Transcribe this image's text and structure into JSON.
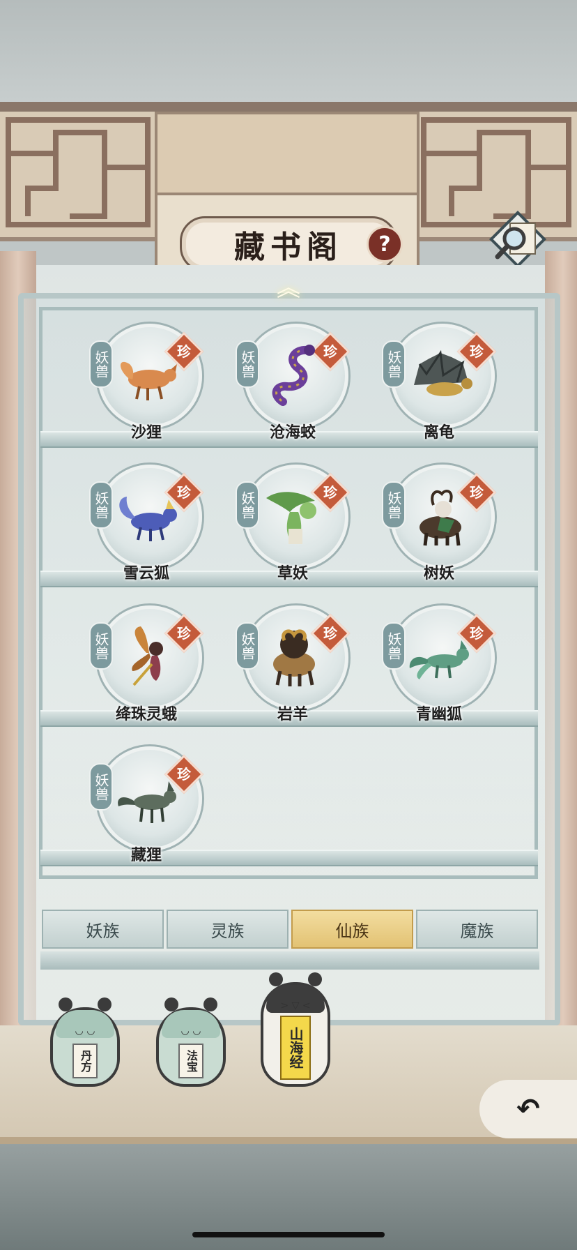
{
  "title": "藏书阁",
  "help_icon": "question-mark-icon",
  "search_icon": "magnifier-scroll-icon",
  "category_tag": "妖兽",
  "rarity_tag": "珍",
  "creatures": [
    {
      "name": "沙狸",
      "icon": "sand-fox-icon",
      "color": "#d98a4e"
    },
    {
      "name": "沧海蛟",
      "icon": "sea-serpent-icon",
      "color": "#6b3f9a"
    },
    {
      "name": "离龟",
      "icon": "spiky-turtle-icon",
      "color": "#4e5655"
    },
    {
      "name": "雪云狐",
      "icon": "snow-cloud-fox-icon",
      "color": "#4d5db8"
    },
    {
      "name": "草妖",
      "icon": "grass-spirit-icon",
      "color": "#5f9a4a"
    },
    {
      "name": "树妖",
      "icon": "tree-spirit-icon",
      "color": "#4b3a2c"
    },
    {
      "name": "绛珠灵蛾",
      "icon": "crimson-moth-icon",
      "color": "#c9843a"
    },
    {
      "name": "岩羊",
      "icon": "rock-goat-icon",
      "color": "#a07844"
    },
    {
      "name": "青幽狐",
      "icon": "green-ghost-fox-icon",
      "color": "#5f9e84"
    },
    {
      "name": "藏狸",
      "icon": "hidden-fox-icon",
      "color": "#5d6d5e"
    }
  ],
  "tabs": [
    {
      "label": "妖族",
      "active": false
    },
    {
      "label": "灵族",
      "active": false
    },
    {
      "label": "仙族",
      "active": true
    },
    {
      "label": "魔族",
      "active": false
    }
  ],
  "bottom_nav": [
    {
      "label": "丹方",
      "active": false
    },
    {
      "label": "法宝",
      "active": false
    },
    {
      "label": "山海经",
      "active": true
    }
  ],
  "back_icon": "back-arrow-icon",
  "colors": {
    "rarity": "#c45b3b",
    "active_tab": "#e8c97c",
    "tag": "#7d9a9e"
  }
}
